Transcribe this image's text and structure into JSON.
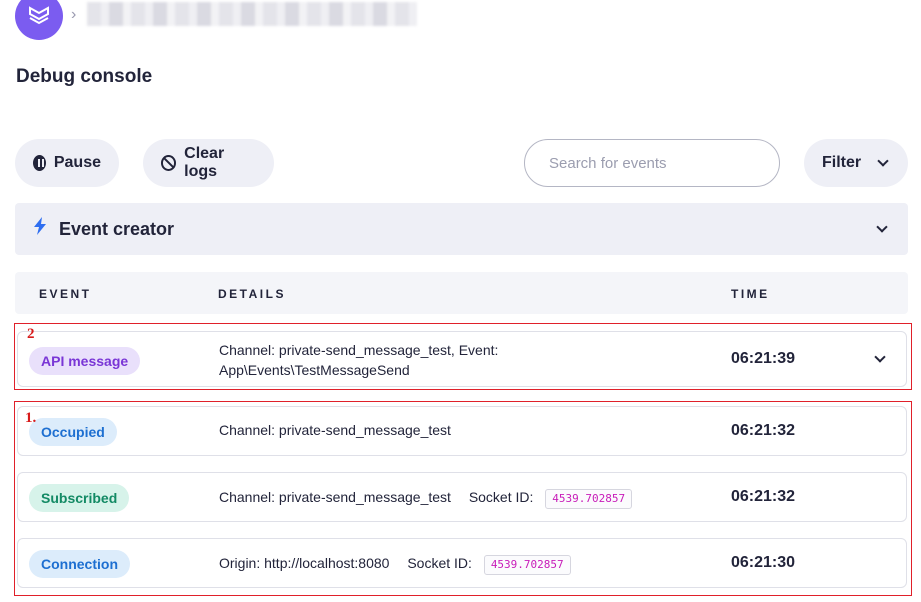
{
  "header": {
    "logo_icon": "layers-logo-icon",
    "breadcrumb_separator": "›"
  },
  "page": {
    "title": "Debug console"
  },
  "toolbar": {
    "pause_label": "Pause",
    "clear_label": "Clear logs",
    "search_placeholder": "Search for events",
    "search_value": "",
    "filter_label": "Filter"
  },
  "event_creator": {
    "label": "Event creator",
    "icon": "bolt-icon"
  },
  "table": {
    "headers": {
      "event": "EVENT",
      "details": "DETAILS",
      "time": "TIME"
    },
    "rows": [
      {
        "event": "API message",
        "details_line1": "Channel: private-send_message_test, Event:",
        "details_line2": "App\\Events\\TestMessageSend",
        "time": "06:21:39"
      },
      {
        "event": "Occupied",
        "details": "Channel: private-send_message_test",
        "time": "06:21:32"
      },
      {
        "event": "Subscribed",
        "details": "Channel: private-send_message_test",
        "socket_label": "Socket ID:",
        "socket_id": "4539.702857",
        "time": "06:21:32"
      },
      {
        "event": "Connection",
        "details": "Origin: http://localhost:8080",
        "socket_label": "Socket ID:",
        "socket_id": "4539.702857",
        "time": "06:21:30"
      }
    ]
  },
  "annotations": {
    "box1": "1.",
    "box2": "2"
  },
  "colors": {
    "api_badge_bg": "#e9e0fb",
    "api_badge_fg": "#7a36d6",
    "occupied_badge_bg": "#dcecfb",
    "occupied_badge_fg": "#1d6fd1",
    "subscribed_badge_bg": "#d7f3ea",
    "subscribed_badge_fg": "#138a64",
    "connection_badge_bg": "#dcecfb",
    "connection_badge_fg": "#1d6fd1",
    "annotation_red": "#e0202a",
    "accent_purple": "#7b5cf0"
  }
}
